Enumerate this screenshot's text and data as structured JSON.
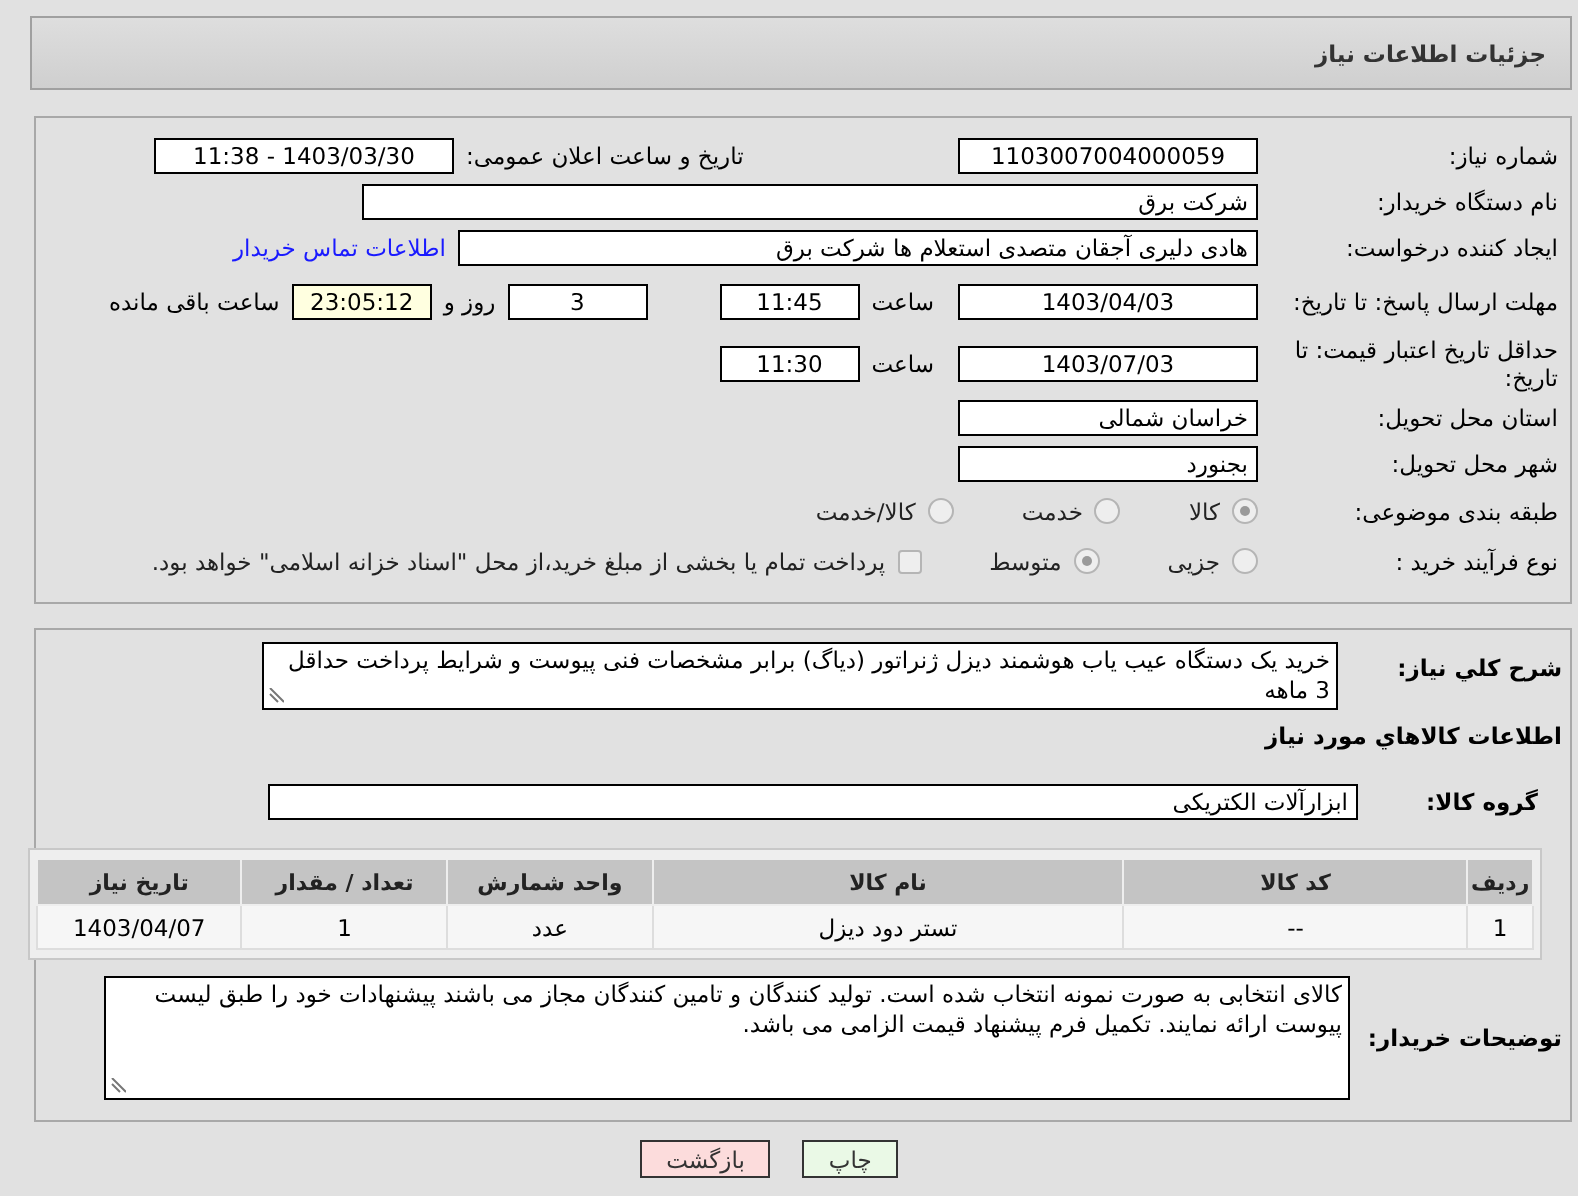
{
  "header": {
    "title": "جزئیات اطلاعات نیاز"
  },
  "need_number": {
    "label": "شماره نیاز:",
    "value": "1103007004000059"
  },
  "announce": {
    "label": "تاریخ و ساعت اعلان عمومی:",
    "value": "1403/03/30 - 11:38"
  },
  "buyer": {
    "label": "نام دستگاه خریدار:",
    "value": "شرکت برق"
  },
  "creator": {
    "label": "ایجاد کننده درخواست:",
    "value": "هادی دلیری آجقان متصدی استعلام ها  شرکت برق",
    "link": "اطلاعات تماس خریدار"
  },
  "deadline": {
    "label": "مهلت ارسال پاسخ: تا تاریخ:",
    "date": "1403/04/03",
    "time_label": "ساعت",
    "time": "11:45",
    "days": "3",
    "days_label": "روز و",
    "remaining": "23:05:12",
    "remaining_label": "ساعت باقی مانده"
  },
  "validity": {
    "label": "حداقل تاریخ اعتبار قیمت: تا تاریخ:",
    "date": "1403/07/03",
    "time_label": "ساعت",
    "time": "11:30"
  },
  "province": {
    "label": "استان محل تحویل:",
    "value": "خراسان شمالی"
  },
  "city": {
    "label": "شهر محل تحویل:",
    "value": "بجنورد"
  },
  "category": {
    "label": "طبقه بندی موضوعی:",
    "options": [
      {
        "kind": "radio",
        "label": "کالا",
        "selected": true
      },
      {
        "kind": "radio",
        "label": "خدمت",
        "selected": false
      },
      {
        "kind": "radio",
        "label": "کالا/خدمت",
        "selected": false
      }
    ]
  },
  "process": {
    "label": "نوع فرآیند خرید :",
    "options": [
      {
        "kind": "radio",
        "label": "جزیی",
        "selected": false
      },
      {
        "kind": "radio",
        "label": "متوسط",
        "selected": true
      },
      {
        "kind": "checkbox",
        "label": "پرداخت تمام یا بخشی از مبلغ خرید،از محل \"اسناد خزانه اسلامی\" خواهد بود.",
        "checked": false
      }
    ]
  },
  "description": {
    "label": "شرح کلي نياز:",
    "value": "خرید یک دستگاه عیب یاب هوشمند دیزل ژنراتور (دیاگ) برابر مشخصات فنی پیوست و شرایط پرداخت حداقل 3 ماهه"
  },
  "goods_heading": "اطلاعات کالاهاي مورد نياز",
  "goods_group": {
    "label": "گروه کالا:",
    "value": "ابزارآلات الکتریکی"
  },
  "table": {
    "columns": [
      "ردیف",
      "کد کالا",
      "نام کالا",
      "واحد شمارش",
      "تعداد / مقدار",
      "تاریخ نیاز"
    ],
    "rows": [
      [
        "1",
        "--",
        "تستر دود دیزل",
        "عدد",
        "1",
        "1403/04/07"
      ]
    ]
  },
  "buyer_notes": {
    "label": "توضیحات خریدار:",
    "value": "کالای انتخابی به صورت نمونه انتخاب شده است. تولید کنندگان و تامین کنندگان مجاز می باشند پیشنهادات خود را طبق لیست پیوست ارائه نمایند. تکمیل فرم پیشنهاد قیمت الزامی می باشد."
  },
  "buttons": [
    {
      "kind": "print",
      "label": "چاپ"
    },
    {
      "kind": "back",
      "label": "بازگشت"
    }
  ]
}
